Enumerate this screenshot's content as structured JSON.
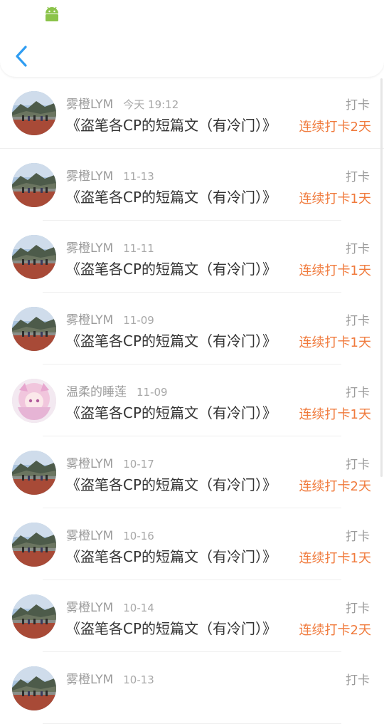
{
  "status_bar": {
    "icon": "android-icon"
  },
  "header": {
    "back_icon": "chevron-left-icon",
    "accent": "#2f9df2"
  },
  "colors": {
    "streak": "#f07a3c",
    "meta": "#9b9b9b",
    "title": "#333333"
  },
  "entries": [
    {
      "user": "雾橙LYM",
      "time": "今天 19:12",
      "title": "《盗笔各CP的短篇文（有冷门）》",
      "action": "打卡",
      "streak": "连续打卡2天",
      "avatar": "landscape"
    },
    {
      "user": "雾橙LYM",
      "time": "11-13",
      "title": "《盗笔各CP的短篇文（有冷门）》",
      "action": "打卡",
      "streak": "连续打卡1天",
      "avatar": "landscape"
    },
    {
      "user": "雾橙LYM",
      "time": "11-11",
      "title": "《盗笔各CP的短篇文（有冷门）》",
      "action": "打卡",
      "streak": "连续打卡1天",
      "avatar": "landscape"
    },
    {
      "user": "雾橙LYM",
      "time": "11-09",
      "title": "《盗笔各CP的短篇文（有冷门）》",
      "action": "打卡",
      "streak": "连续打卡1天",
      "avatar": "landscape"
    },
    {
      "user": "温柔的睡莲",
      "time": "11-09",
      "title": "《盗笔各CP的短篇文（有冷门）》",
      "action": "打卡",
      "streak": "连续打卡1天",
      "avatar": "anime"
    },
    {
      "user": "雾橙LYM",
      "time": "10-17",
      "title": "《盗笔各CP的短篇文（有冷门）》",
      "action": "打卡",
      "streak": "连续打卡2天",
      "avatar": "landscape"
    },
    {
      "user": "雾橙LYM",
      "time": "10-16",
      "title": "《盗笔各CP的短篇文（有冷门）》",
      "action": "打卡",
      "streak": "连续打卡1天",
      "avatar": "landscape"
    },
    {
      "user": "雾橙LYM",
      "time": "10-14",
      "title": "《盗笔各CP的短篇文（有冷门）》",
      "action": "打卡",
      "streak": "连续打卡2天",
      "avatar": "landscape"
    },
    {
      "user": "雾橙LYM",
      "time": "10-13",
      "title": "",
      "action": "打卡",
      "streak": "",
      "avatar": "landscape"
    }
  ]
}
